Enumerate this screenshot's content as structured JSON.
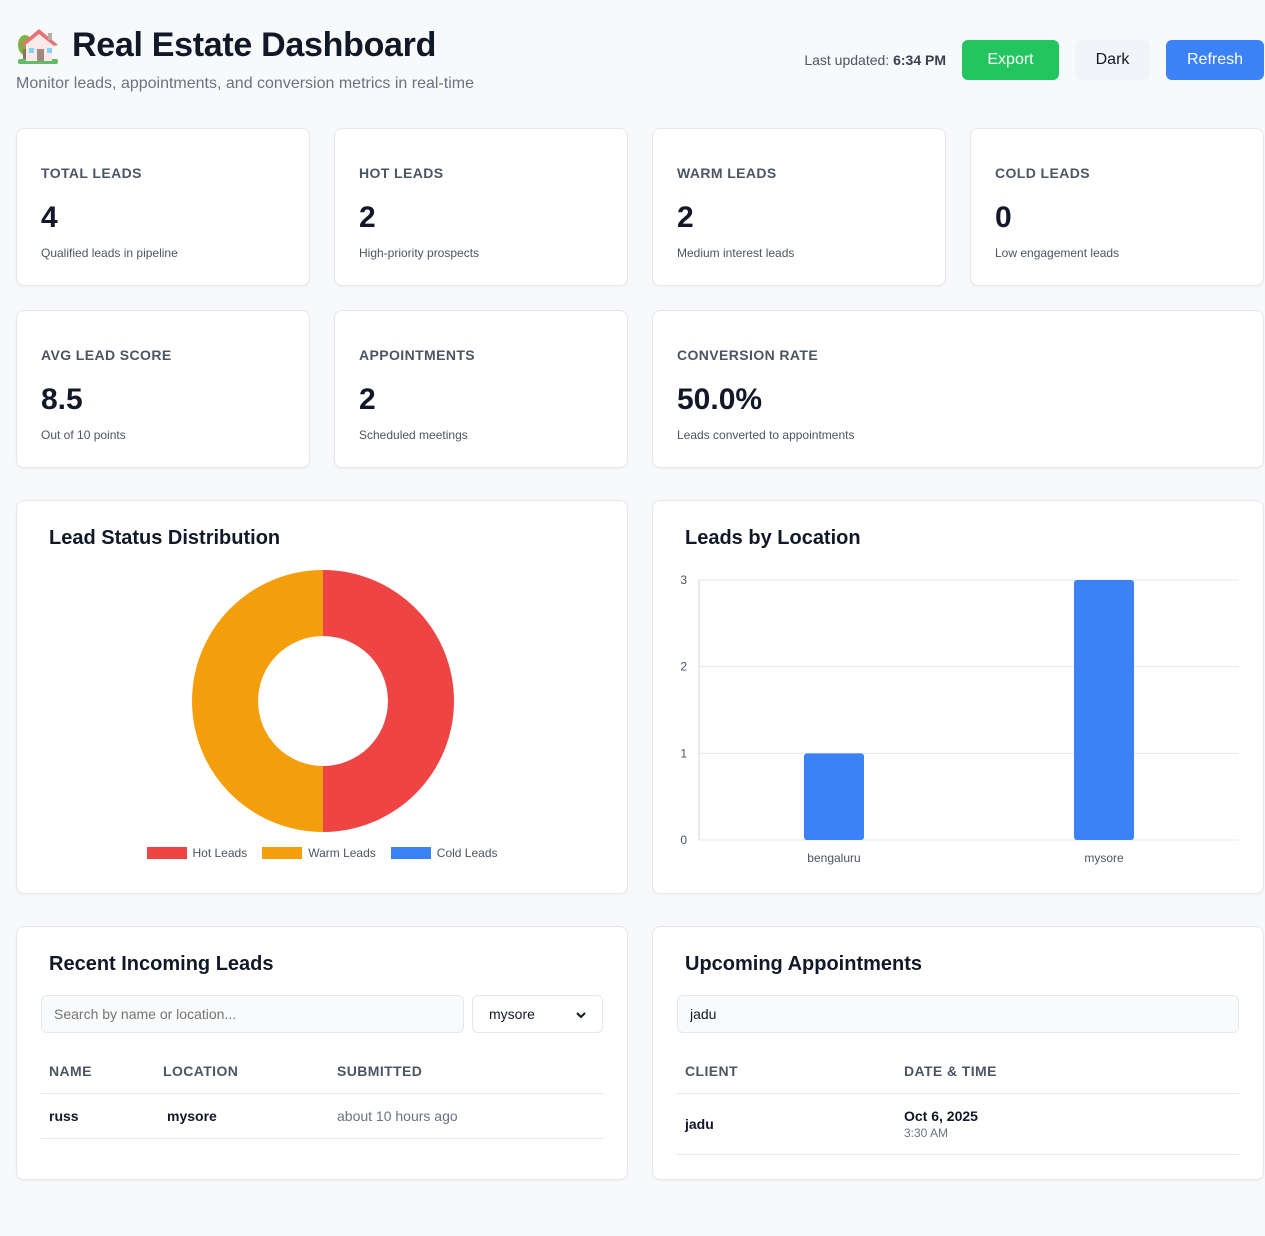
{
  "header": {
    "title": "Real Estate Dashboard",
    "subtitle": "Monitor leads, appointments, and conversion metrics in real-time",
    "last_updated_label": "Last updated:",
    "last_updated_time": "6:34 PM",
    "export_label": "Export",
    "dark_label": "Dark",
    "refresh_label": "Refresh"
  },
  "stats": [
    {
      "label": "TOTAL LEADS",
      "value": "4",
      "desc": "Qualified leads in pipeline"
    },
    {
      "label": "HOT LEADS",
      "value": "2",
      "desc": "High-priority prospects"
    },
    {
      "label": "WARM LEADS",
      "value": "2",
      "desc": "Medium interest leads"
    },
    {
      "label": "COLD LEADS",
      "value": "0",
      "desc": "Low engagement leads"
    },
    {
      "label": "AVG LEAD SCORE",
      "value": "8.5",
      "desc": "Out of 10 points"
    },
    {
      "label": "APPOINTMENTS",
      "value": "2",
      "desc": "Scheduled meetings"
    },
    {
      "label": "CONVERSION RATE",
      "value": "50.0%",
      "desc": "Leads converted to appointments"
    }
  ],
  "panels": {
    "status_title": "Lead Status Distribution",
    "location_title": "Leads by Location",
    "recent_title": "Recent Incoming Leads",
    "appointments_title": "Upcoming Appointments"
  },
  "chart_data": [
    {
      "type": "pie",
      "title": "Lead Status Distribution",
      "categories": [
        "Hot Leads",
        "Warm Leads",
        "Cold Leads"
      ],
      "values": [
        2,
        2,
        0
      ],
      "colors": [
        "#ef4444",
        "#f59e0b",
        "#3b82f6"
      ],
      "legend": "bottom"
    },
    {
      "type": "bar",
      "title": "Leads by Location",
      "categories": [
        "bengaluru",
        "mysore"
      ],
      "values": [
        1,
        3
      ],
      "yticks": [
        "0",
        "1",
        "2",
        "3"
      ],
      "ylim": [
        0,
        3
      ],
      "color": "#3b82f6",
      "grid": true
    }
  ],
  "recent_leads": {
    "search_placeholder": "Search by name or location...",
    "filter_value": "mysore",
    "columns": [
      "NAME",
      "LOCATION",
      "SUBMITTED"
    ],
    "rows": [
      {
        "name": "russ",
        "location": "mysore",
        "submitted": "about 10 hours ago"
      }
    ]
  },
  "appointments": {
    "search_value": "jadu",
    "columns": [
      "CLIENT",
      "DATE & TIME"
    ],
    "rows": [
      {
        "client": "jadu",
        "date": "Oct 6, 2025",
        "time": "3:30 AM"
      }
    ]
  },
  "icons": {
    "title_icon": "house-with-garden-icon",
    "select_icon": "chevron-down-icon"
  }
}
